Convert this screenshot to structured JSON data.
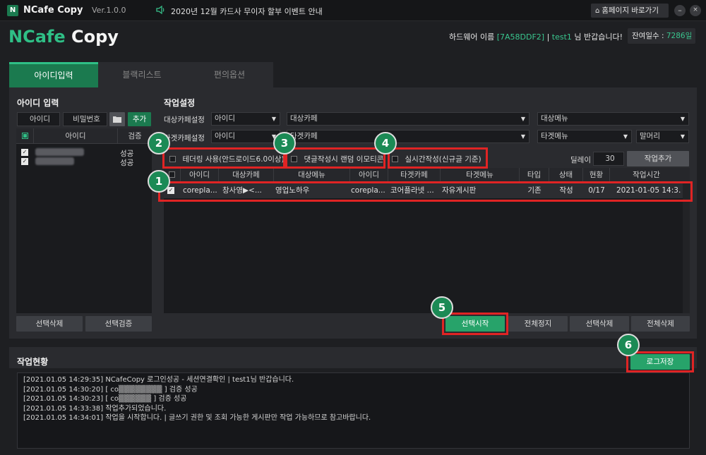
{
  "titlebar": {
    "logo_letter": "N",
    "app_name": "NCafe Copy",
    "version": "Ver.1.0.0",
    "notice_icon": "speaker-icon",
    "notice": "2020년 12월 카드사 무이자 할부 이벤트 안내",
    "home_button": "홈페이지 바로가기",
    "minimize": "–",
    "close": "×"
  },
  "header": {
    "brand_n": "NCafe",
    "brand_rest": " Copy",
    "hw_label": "하드웨어 이름 ",
    "hw_id": "[7A58DDF2]",
    "separator": " | ",
    "user": "test1",
    "greeting": " 님 반갑습니다!",
    "days_label": "잔여일수 : ",
    "days_value": "7286일"
  },
  "tabs": [
    "아이디입력",
    "블랙리스트",
    "편의옵션"
  ],
  "id_input": {
    "title": "아이디 입력",
    "id_placeholder": "아이디",
    "pw_placeholder": "비밀번호",
    "folder_icon": "folder-icon",
    "add_button": "추가",
    "list_headers": [
      "아이디",
      "검증"
    ],
    "rows": [
      {
        "id": "co▒▒▒▒▒▒▒▒",
        "status": "성공"
      },
      {
        "id": "co▒▒▒▒▒▒",
        "status": "성공"
      }
    ],
    "delete_button": "선택삭제",
    "verify_button": "선택검증"
  },
  "work_settings": {
    "title": "작업설정",
    "source_label": "대상카페설정",
    "target_label": "타겟카페설정",
    "source_id": "아이디",
    "source_cafe": "대상카페",
    "source_menu": "대상메뉴",
    "target_id": "아이디",
    "target_cafe": "타겟카페",
    "target_menu": "타겟메뉴",
    "target_header": "말머리",
    "opt_tethering": "테더링 사용(안드로이드6.0이상)",
    "opt_emoticon": "댓글작성시 랜덤 이모티콘",
    "opt_realtime": "실시간작성(신규글 기준)",
    "delay_label": "딜레이",
    "delay_value": "30",
    "add_task_button": "작업추가",
    "table_headers": [
      "아이디",
      "대상카페",
      "대상메뉴",
      "아이디",
      "타겟카페",
      "타겟메뉴",
      "타입",
      "상태",
      "현황",
      "작업시간"
    ],
    "table_rows": [
      [
        "corepla...",
        "창사영▶<...",
        "영업노하우",
        "corepla...",
        "코어플라넷 ...",
        "자유게시판",
        "기존",
        "작성",
        "0/17",
        "2021-01-05 14:3..."
      ]
    ],
    "start_button": "선택시작",
    "stop_all_button": "전체정지",
    "delete_sel_button": "선택삭제",
    "delete_all_button": "전체삭제"
  },
  "status": {
    "title": "작업현황",
    "save_log_button": "로그저장",
    "log": [
      "[2021.01.05 14:29:35]  NCafeCopy 로그인성공 - 세션연결확인  | test1님 반갑습니다.",
      "[2021.01.05 14:30:20]  [ co▒▒▒▒▒▒▒▒ ] 검증 성공",
      "[2021.01.05 14:30:23]  [ co▒▒▒▒▒▒ ] 검증 성공",
      "[2021.01.05 14:33:38]  작업추가되었습니다.",
      "[2021.01.05 14:34:01]  작업을 시작합니다. | 글쓰기 권한 및 조회 가능한 게시판만 작업 가능하므로 참고바랍니다."
    ]
  },
  "callouts": [
    "1",
    "2",
    "3",
    "4",
    "5",
    "6"
  ],
  "colors": {
    "accent": "#1b7a4f",
    "highlight": "#e02424",
    "background": "#1e1f22"
  }
}
